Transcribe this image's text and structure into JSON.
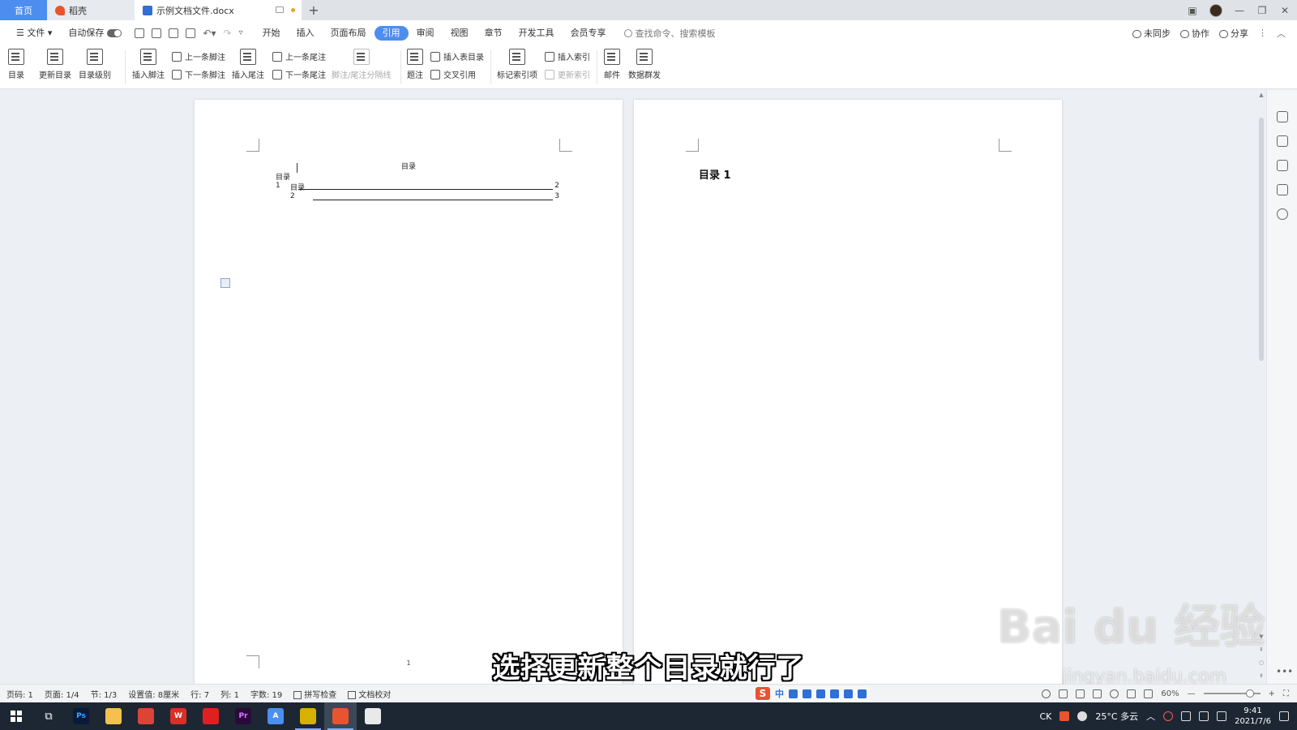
{
  "tabs": {
    "home": "首页",
    "shell": "稻壳",
    "doc": "示例文档文件.docx",
    "new": "+"
  },
  "menubar": {
    "file": "文件",
    "autosave": "自动保存",
    "items": [
      "开始",
      "插入",
      "页面布局",
      "引用",
      "审阅",
      "视图",
      "章节",
      "开发工具",
      "会员专享"
    ],
    "active_index": 3,
    "search_placeholder": "查找命令、搜索模板",
    "right": {
      "sync": "未同步",
      "collab": "协作",
      "share": "分享"
    }
  },
  "ribbon": {
    "toc": "目录",
    "update_toc": "更新目录",
    "toc_level": "目录级别",
    "insert_footnote": "插入脚注",
    "prev_footnote": "上一条脚注",
    "next_footnote": "下一条脚注",
    "insert_endnote": "插入尾注",
    "prev_endnote": "上一条尾注",
    "next_endnote": "下一条尾注",
    "separator_line": "脚注/尾注分隔线",
    "caption": "题注",
    "insert_table_of_figures": "插入表目录",
    "cross_reference": "交叉引用",
    "mark_index": "标记索引项",
    "insert_index": "插入索引",
    "update_index": "更新索引",
    "mail": "邮件",
    "data_send": "数据群发"
  },
  "document": {
    "page1": {
      "toc_title": "目录",
      "entries": [
        {
          "label": "目录 1",
          "page": "2"
        },
        {
          "label": "目录 2",
          "page": "3"
        }
      ],
      "page_number": "1"
    },
    "page2": {
      "heading": "目录 1"
    }
  },
  "subtitle": "选择更新整个目录就行了",
  "watermark": {
    "main": "Bai du 经验",
    "sub": "jingyan.baidu.com"
  },
  "statusbar": {
    "page_code": "页码: 1",
    "pages": "页面: 1/4",
    "section": "节: 1/3",
    "setting": "设置值: 8厘米",
    "row": "行: 7",
    "col": "列: 1",
    "words": "字数: 19",
    "spellcheck": "拼写检查",
    "proofread": "文档校对",
    "zoom": "60%"
  },
  "ime": {
    "logo": "S",
    "mode": "中"
  },
  "taskbar": {
    "apps": [
      {
        "name": "ps",
        "label": "Ps",
        "color": "#0a1a3a",
        "fg": "#31a8ff"
      },
      {
        "name": "explorer",
        "label": "",
        "color": "#f2c14e",
        "fg": "#fff"
      },
      {
        "name": "chrome",
        "label": "",
        "color": "#db4437",
        "fg": "#fff"
      },
      {
        "name": "wps",
        "label": "W",
        "color": "#d93025",
        "fg": "#fff"
      },
      {
        "name": "netease",
        "label": "",
        "color": "#e02020",
        "fg": "#fff"
      },
      {
        "name": "premiere",
        "label": "Pr",
        "color": "#2a0a3a",
        "fg": "#e07aff"
      },
      {
        "name": "app-a",
        "label": "A",
        "color": "#4b8ff0",
        "fg": "#fff"
      },
      {
        "name": "clapper",
        "label": "",
        "color": "#d7b100",
        "fg": "#fff"
      },
      {
        "name": "wps-writer",
        "label": "",
        "color": "#e8542f",
        "fg": "#fff"
      },
      {
        "name": "other",
        "label": "",
        "color": "#e9e9e9",
        "fg": "#d33"
      }
    ],
    "tray": {
      "lang": "CK",
      "weather": "25°C  多云",
      "time": "9:41",
      "date": "2021/7/6"
    }
  }
}
